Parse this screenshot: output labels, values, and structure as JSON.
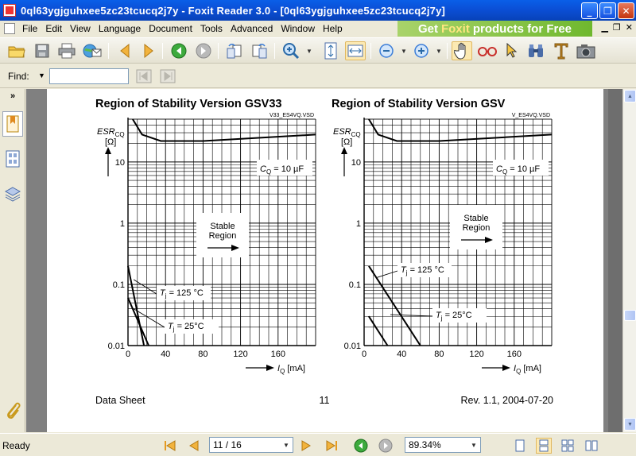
{
  "window": {
    "title": "0ql63ygjguhxee5zc23tcucq2j7y - Foxit Reader 3.0 - [0ql63ygjguhxee5zc23tcucq2j7y]",
    "minimize": "_",
    "maximize": "❐",
    "close": "✕"
  },
  "menu": {
    "items": [
      "File",
      "Edit",
      "View",
      "Language",
      "Document",
      "Tools",
      "Advanced",
      "Window",
      "Help"
    ],
    "ad_prefix": "Get",
    "ad_highlight": "Foxit",
    "ad_suffix": "products for Free"
  },
  "find": {
    "label": "Find:",
    "value": ""
  },
  "status": {
    "text": "Ready",
    "page": "11 / 16",
    "zoom": "89.34%"
  },
  "document": {
    "footer_left": "Data Sheet",
    "footer_center": "11",
    "footer_right": "Rev. 1.1, 2004-07-20"
  },
  "colors": {
    "titlebar": "#0A5FE8",
    "ad": "#6FB82E",
    "page": "#FFFFFF",
    "workspace": "#808080"
  },
  "chart_data": [
    {
      "type": "line",
      "title": "Region of Stability Version GSV33",
      "file_tag": "V33_ES4VQ.VSD",
      "ylabel_main": "ESR",
      "ylabel_sub": "CQ",
      "ylabel_unit": "[Ω]",
      "xlabel_main": "I",
      "xlabel_sub": "Q",
      "xlabel_unit": "[mA]",
      "yscale": "log",
      "ylim": [
        0.01,
        50
      ],
      "xlim": [
        0,
        200
      ],
      "yticks": [
        "0.01",
        "0.1",
        "1",
        "10"
      ],
      "xticks": [
        "0",
        "40",
        "80",
        "120",
        "160"
      ],
      "annotation_cap": "C",
      "annotation_cap_sub": "Q",
      "annotation_cap_value": "= 10 µF",
      "region_label_1": "Stable",
      "region_label_2": "Region",
      "series": [
        {
          "label_main": "T",
          "label_sub": "j",
          "label_value": "= 125 °C",
          "x": [
            0,
            17
          ],
          "y": [
            0.2,
            0.01
          ]
        },
        {
          "label_main": "T",
          "label_sub": "j",
          "label_value": "= 25°C",
          "x": [
            0,
            22
          ],
          "y": [
            0.06,
            0.01
          ]
        },
        {
          "x": [
            5,
            15,
            35,
            80,
            200
          ],
          "y": [
            50,
            28,
            22,
            22,
            28
          ]
        }
      ]
    },
    {
      "type": "line",
      "title": "Region of Stability Version GSV",
      "file_tag": "V_ES4VQ.VSD",
      "ylabel_main": "ESR",
      "ylabel_sub": "CQ",
      "ylabel_unit": "[Ω]",
      "xlabel_main": "I",
      "xlabel_sub": "Q",
      "xlabel_unit": "[mA]",
      "yscale": "log",
      "ylim": [
        0.01,
        50
      ],
      "xlim": [
        0,
        200
      ],
      "yticks": [
        "0.01",
        "0.1",
        "1",
        "10"
      ],
      "xticks": [
        "0",
        "40",
        "80",
        "120",
        "160"
      ],
      "annotation_cap": "C",
      "annotation_cap_sub": "Q",
      "annotation_cap_value": "= 10 µF",
      "region_label_1": "Stable",
      "region_label_2": "Region",
      "series": [
        {
          "label_main": "T",
          "label_sub": "j",
          "label_value": "= 125 °C",
          "x": [
            5,
            60
          ],
          "y": [
            0.2,
            0.01
          ]
        },
        {
          "label_main": "T",
          "label_sub": "j",
          "label_value": "= 25°C",
          "x": [
            5,
            25
          ],
          "y": [
            0.03,
            0.01
          ]
        },
        {
          "x": [
            5,
            15,
            35,
            80,
            200
          ],
          "y": [
            50,
            28,
            22,
            22,
            28
          ]
        }
      ]
    }
  ]
}
